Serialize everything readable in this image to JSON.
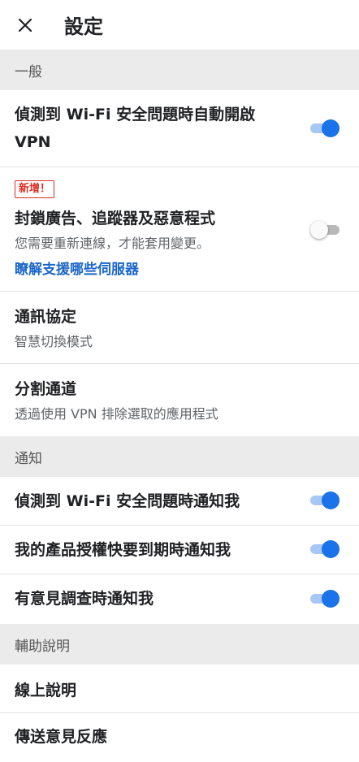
{
  "header": {
    "title": "設定"
  },
  "sections": {
    "general": {
      "label": "一般",
      "wifi_vpn_line1": "偵測到 Wi-Fi 安全問題時自動開啟",
      "wifi_vpn_line2": "VPN",
      "block_badge": "新增！",
      "block_title": "封鎖廣告、追蹤器及惡意程式",
      "block_sub": "您需要重新連線，才能套用變更。",
      "block_link": "瞭解支援哪些伺服器",
      "protocol_title": "通訊協定",
      "protocol_value": "智慧切換模式",
      "split_title": "分割通道",
      "split_sub": "透過使用 VPN 排除選取的應用程式"
    },
    "notify": {
      "label": "通知",
      "wifi_notify": "偵測到 Wi-Fi 安全問題時通知我",
      "license_notify": "我的產品授權快要到期時通知我",
      "survey_notify": "有意見調查時通知我"
    },
    "help": {
      "label": "輔助說明",
      "online_help": "線上說明",
      "feedback": "傳送意見反應"
    }
  },
  "toggles": {
    "wifi_vpn": true,
    "block_ads": false,
    "wifi_notify": true,
    "license_notify": true,
    "survey_notify": true
  },
  "colors": {
    "accent": "#1a73e8",
    "link": "#1a66c9",
    "badge": "#d93025"
  },
  "icons": {
    "close": "close-icon"
  }
}
